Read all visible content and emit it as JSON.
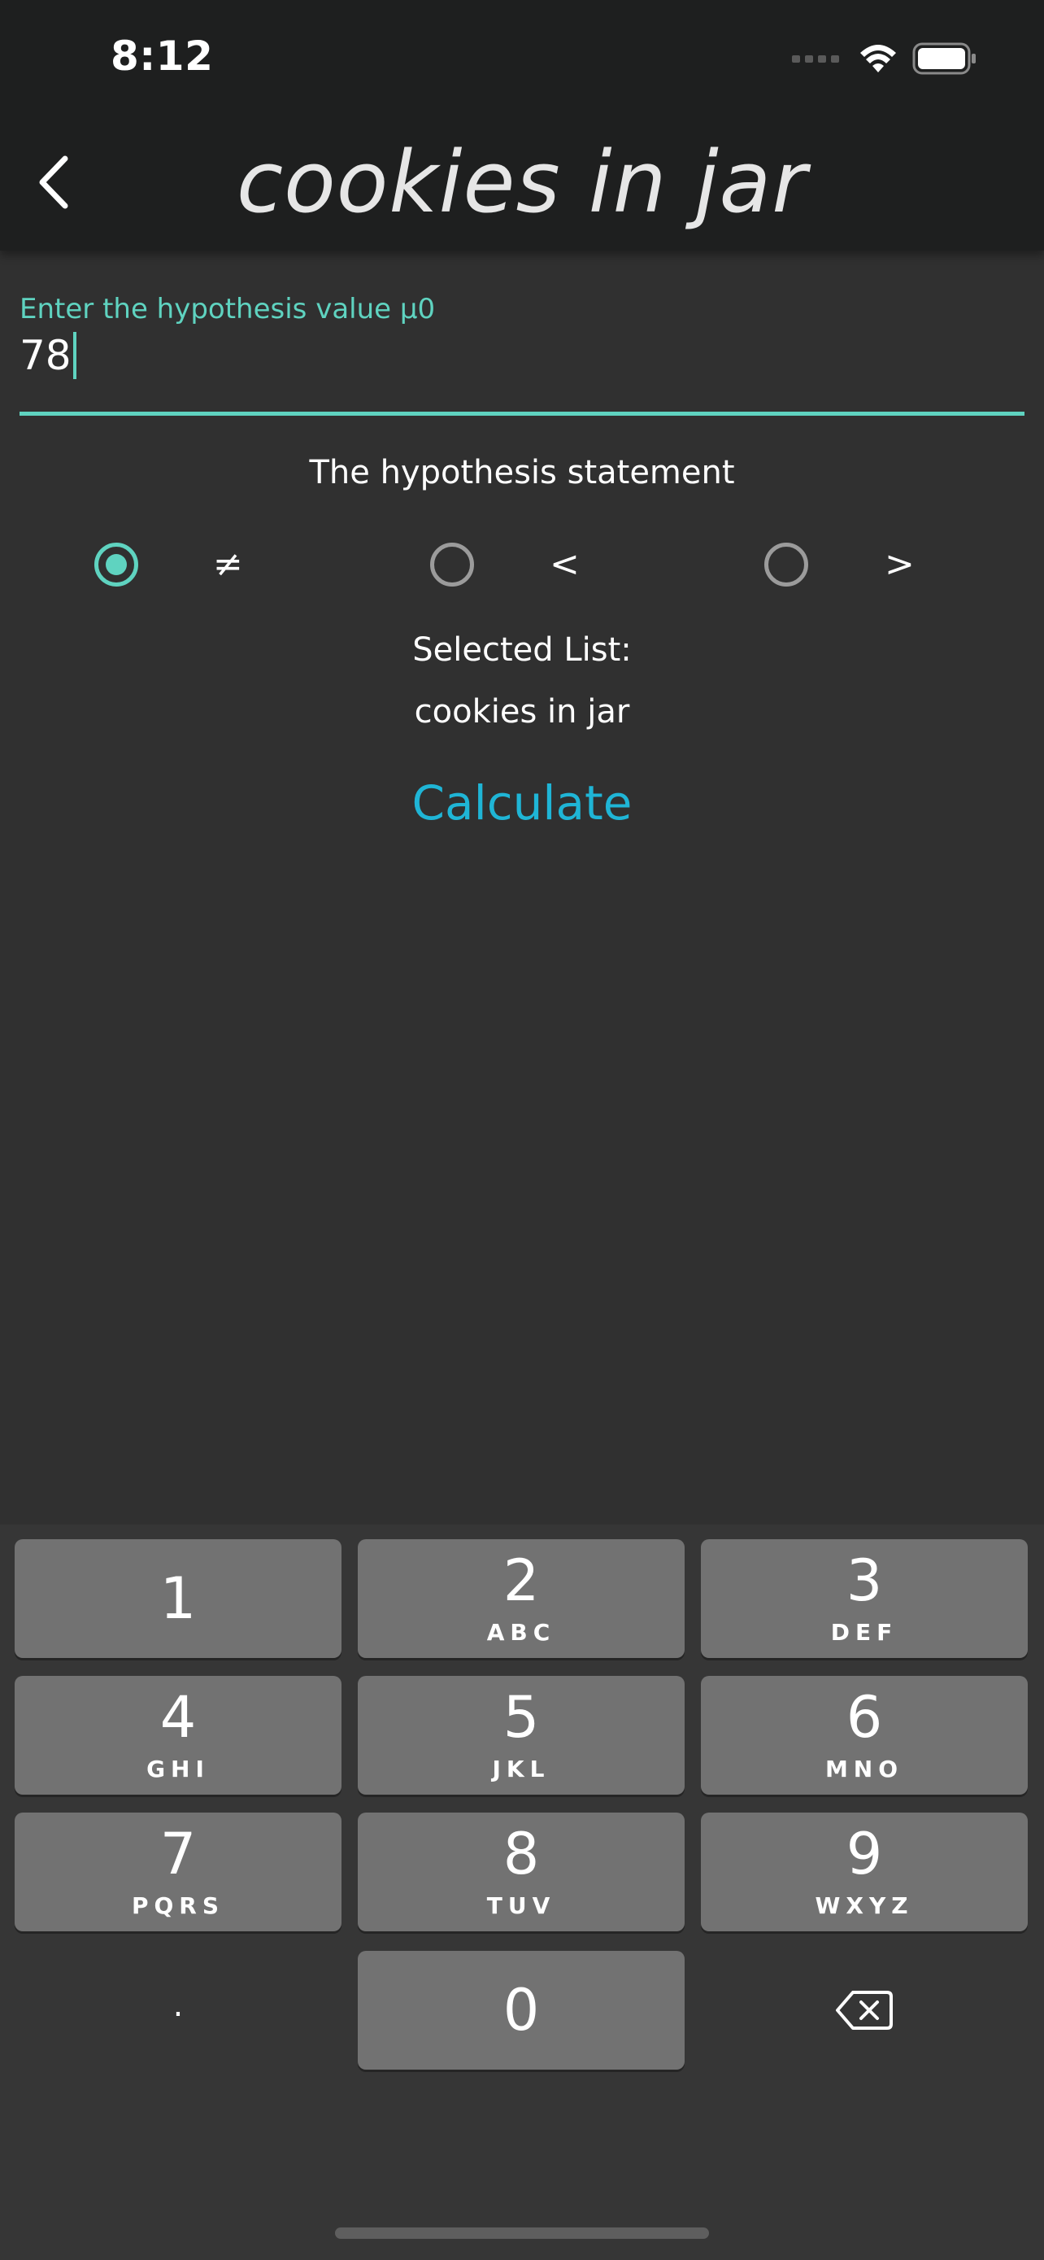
{
  "status_bar": {
    "time": "8:12",
    "icons": [
      "cellular-signal-icon",
      "wifi-icon",
      "battery-icon"
    ]
  },
  "app_bar": {
    "back_icon": "chevron-left-icon",
    "title": "cookies in jar"
  },
  "hypothesis_field": {
    "label": "Enter the hypothesis value µ0",
    "value": "78"
  },
  "statement": {
    "title": "The hypothesis statement",
    "options": [
      {
        "symbol": "≠",
        "selected": true
      },
      {
        "symbol": "<",
        "selected": false
      },
      {
        "symbol": ">",
        "selected": false
      }
    ]
  },
  "selected_list": {
    "label": "Selected List:",
    "value": "cookies in jar"
  },
  "calculate_label": "Calculate",
  "keypad": {
    "keys": [
      {
        "digit": "1",
        "letters": ""
      },
      {
        "digit": "2",
        "letters": "ABC"
      },
      {
        "digit": "3",
        "letters": "DEF"
      },
      {
        "digit": "4",
        "letters": "GHI"
      },
      {
        "digit": "5",
        "letters": "JKL"
      },
      {
        "digit": "6",
        "letters": "MNO"
      },
      {
        "digit": "7",
        "letters": "PQRS"
      },
      {
        "digit": "8",
        "letters": "TUV"
      },
      {
        "digit": "9",
        "letters": "WXYZ"
      },
      {
        "digit": "0",
        "letters": ""
      }
    ],
    "dot_label": ".",
    "backspace_icon": "backspace-icon"
  },
  "colors": {
    "accent": "#5fd3c0",
    "link": "#1fb5d6",
    "app_bar_bg": "#1e1f1f",
    "page_bg": "#303030",
    "key_bg": "#727272",
    "keyboard_bg": "#363636"
  }
}
